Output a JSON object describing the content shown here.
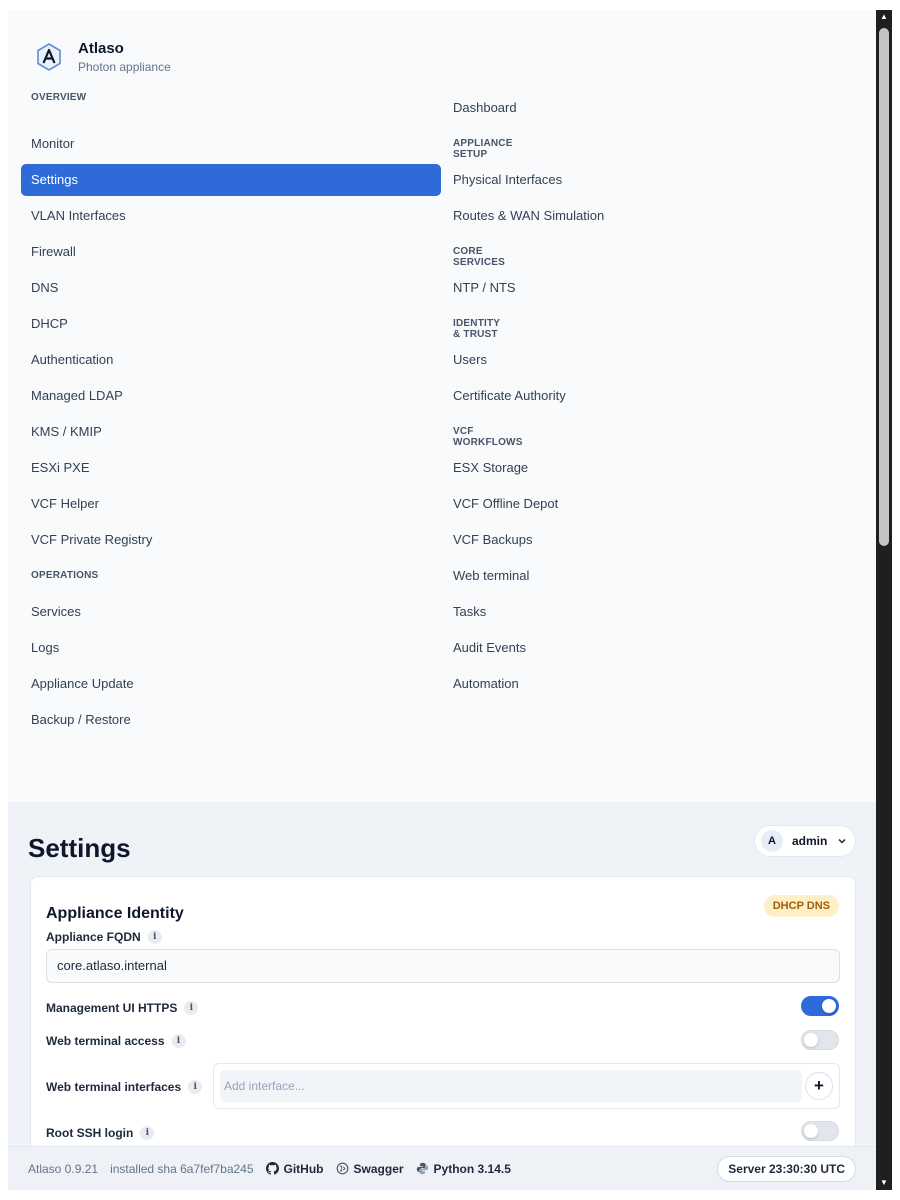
{
  "brand": {
    "name": "Atlaso",
    "subtitle": "Photon appliance"
  },
  "nav": {
    "left": [
      {
        "type": "group",
        "label": "OVERVIEW"
      },
      {
        "type": "item",
        "label": "Monitor"
      },
      {
        "type": "item",
        "label": "Settings",
        "active": true
      },
      {
        "type": "item",
        "label": "VLAN Interfaces"
      },
      {
        "type": "item",
        "label": "Firewall"
      },
      {
        "type": "item",
        "label": "DNS"
      },
      {
        "type": "item",
        "label": "DHCP"
      },
      {
        "type": "item",
        "label": "Authentication"
      },
      {
        "type": "item",
        "label": "Managed LDAP"
      },
      {
        "type": "item",
        "label": "KMS / KMIP"
      },
      {
        "type": "item",
        "label": "ESXi PXE"
      },
      {
        "type": "item",
        "label": "VCF Helper"
      },
      {
        "type": "item",
        "label": "VCF Private Registry"
      },
      {
        "type": "group",
        "label": "OPERATIONS"
      },
      {
        "type": "item",
        "label": "Services"
      },
      {
        "type": "item",
        "label": "Logs"
      },
      {
        "type": "item",
        "label": "Appliance Update"
      },
      {
        "type": "item",
        "label": "Backup / Restore"
      }
    ],
    "right": [
      {
        "type": "item",
        "label": "Dashboard"
      },
      {
        "type": "group",
        "label": "APPLIANCE SETUP"
      },
      {
        "type": "item",
        "label": "Physical Interfaces"
      },
      {
        "type": "item",
        "label": "Routes & WAN Simulation"
      },
      {
        "type": "group",
        "label": "CORE SERVICES"
      },
      {
        "type": "item",
        "label": "NTP / NTS"
      },
      {
        "type": "group",
        "label": "IDENTITY & TRUST"
      },
      {
        "type": "item",
        "label": "Users"
      },
      {
        "type": "item",
        "label": "Certificate Authority"
      },
      {
        "type": "group",
        "label": "VCF WORKFLOWS"
      },
      {
        "type": "item",
        "label": "ESX Storage"
      },
      {
        "type": "item",
        "label": "VCF Offline Depot"
      },
      {
        "type": "item",
        "label": "VCF Backups"
      },
      {
        "type": "item",
        "label": "Web terminal"
      },
      {
        "type": "item",
        "label": "Tasks"
      },
      {
        "type": "item",
        "label": "Audit Events"
      },
      {
        "type": "item",
        "label": "Automation"
      }
    ]
  },
  "page": {
    "title": "Settings"
  },
  "user": {
    "initial": "A",
    "name": "admin"
  },
  "card": {
    "title": "Appliance Identity",
    "badge": "DHCP DNS",
    "fqdn_label": "Appliance FQDN",
    "fqdn_value": "core.atlaso.internal",
    "https_label": "Management UI HTTPS",
    "https_on": true,
    "webterm_label": "Web terminal access",
    "webterm_on": false,
    "webterm_if_label": "Web terminal interfaces",
    "webterm_if_placeholder": "Add interface...",
    "add_symbol": "+",
    "rootssh_label": "Root SSH login",
    "rootssh_on": false,
    "info_symbol": "i"
  },
  "footer": {
    "version": "Atlaso 0.9.21",
    "sha": "installed sha 6a7fef7ba245",
    "github": "GitHub",
    "swagger": "Swagger",
    "python": "Python 3.14.5",
    "server_time": "Server 23:30:30 UTC"
  },
  "colors": {
    "accent": "#2f6ad9",
    "badge_bg": "#fdf0c8",
    "badge_text": "#a15c07"
  },
  "icons": {
    "logo": "atlaso-hex-logo-icon",
    "github": "github-icon",
    "swagger": "swagger-icon",
    "python": "python-icon",
    "chevron": "chevron-down-icon"
  }
}
